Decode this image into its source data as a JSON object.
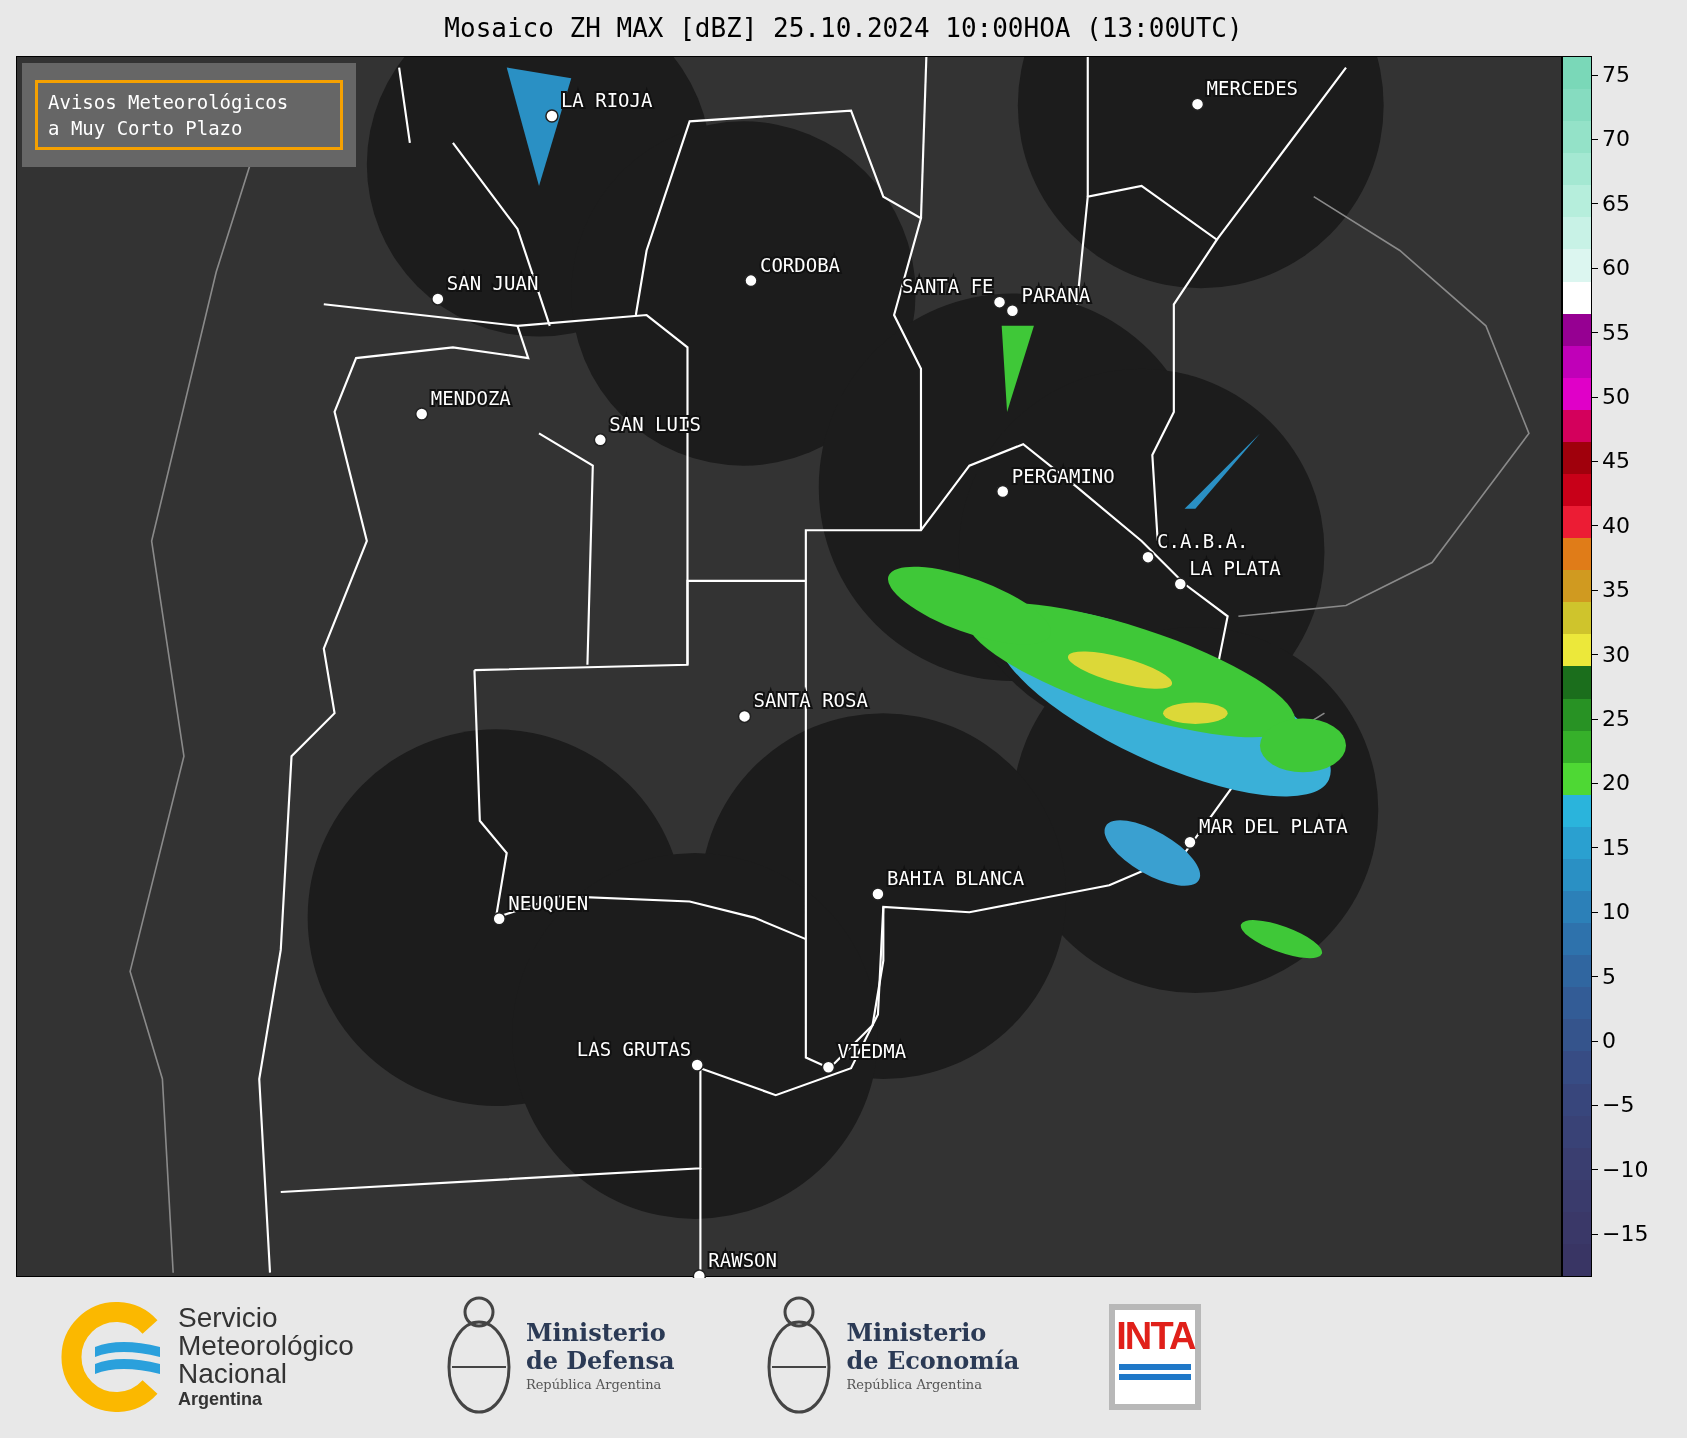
{
  "title": "Mosaico ZH MAX [dBZ] 25.10.2024 10:00HOA (13:00UTC)",
  "notice": [
    "Avisos Meteorológicos",
    "a Muy Corto Plazo"
  ],
  "cities": [
    {
      "name": "LA RIOJA",
      "kind": "right"
    },
    {
      "name": "MERCEDES",
      "kind": "right"
    },
    {
      "name": "CORDOBA",
      "kind": "right"
    },
    {
      "name": "SAN JUAN",
      "kind": "right"
    },
    {
      "name": "SANTA FE",
      "kind": "left"
    },
    {
      "name": "PARANA",
      "kind": "right"
    },
    {
      "name": "MENDOZA",
      "kind": "right"
    },
    {
      "name": "SAN LUIS",
      "kind": "right"
    },
    {
      "name": "PERGAMINO",
      "kind": "right"
    },
    {
      "name": "C.A.B.A.",
      "kind": "right"
    },
    {
      "name": "LA PLATA",
      "kind": "right"
    },
    {
      "name": "SANTA ROSA",
      "kind": "right"
    },
    {
      "name": "MAR DEL PLATA",
      "kind": "right"
    },
    {
      "name": "BAHIA BLANCA",
      "kind": "right"
    },
    {
      "name": "NEUQUEN",
      "kind": "right"
    },
    {
      "name": "LAS GRUTAS",
      "kind": "left"
    },
    {
      "name": "VIEDMA",
      "kind": "right"
    },
    {
      "name": "RAWSON",
      "kind": "right"
    }
  ],
  "colorbar": {
    "ticks": [
      "75",
      "70",
      "65",
      "60",
      "55",
      "50",
      "45",
      "40",
      "35",
      "30",
      "25",
      "20",
      "15",
      "10",
      "5",
      "0",
      "−5",
      "−10",
      "−15"
    ],
    "segments": [
      {
        "color": "#7ad8b8"
      },
      {
        "color": "#86dcc0"
      },
      {
        "color": "#94e2c8"
      },
      {
        "color": "#a4e8d2"
      },
      {
        "color": "#b6eedc"
      },
      {
        "color": "#c8f2e6"
      },
      {
        "color": "#dcf6f0"
      },
      {
        "color": "#ffffff"
      },
      {
        "color": "#960092"
      },
      {
        "color": "#c000b8"
      },
      {
        "color": "#e000c8"
      },
      {
        "color": "#d4005c"
      },
      {
        "color": "#a0000c"
      },
      {
        "color": "#c80018"
      },
      {
        "color": "#ec1c34"
      },
      {
        "color": "#e07c18"
      },
      {
        "color": "#d09a20"
      },
      {
        "color": "#cfc42c"
      },
      {
        "color": "#ece83a"
      },
      {
        "color": "#1b6e1c"
      },
      {
        "color": "#289224"
      },
      {
        "color": "#36b02a"
      },
      {
        "color": "#4ed834"
      },
      {
        "color": "#2ab4dc"
      },
      {
        "color": "#2aa0d0"
      },
      {
        "color": "#2a90c4"
      },
      {
        "color": "#2c80b8"
      },
      {
        "color": "#2e72ac"
      },
      {
        "color": "#3066a0"
      },
      {
        "color": "#335c96"
      },
      {
        "color": "#35548c"
      },
      {
        "color": "#374c84"
      },
      {
        "color": "#38467c"
      },
      {
        "color": "#394276"
      },
      {
        "color": "#3a3e70"
      },
      {
        "color": "#3a3b6c"
      },
      {
        "color": "#3a3868"
      },
      {
        "color": "#393564"
      }
    ]
  },
  "footer": {
    "smn": [
      "Servicio",
      "Meteorológico",
      "Nacional"
    ],
    "smn_country": "Argentina",
    "ministries": [
      {
        "lines": [
          "Ministerio",
          "de Defensa"
        ],
        "country": "República Argentina"
      },
      {
        "lines": [
          "Ministerio",
          "de Economía"
        ],
        "country": "República Argentina"
      }
    ],
    "inta": "INTA"
  }
}
